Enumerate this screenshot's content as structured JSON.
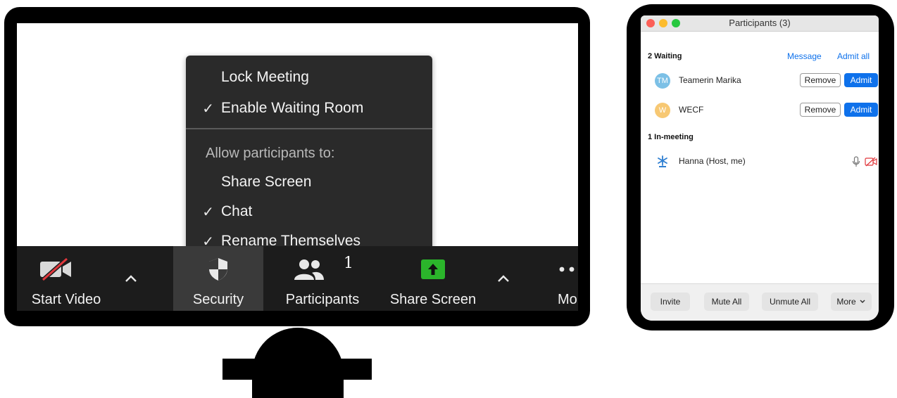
{
  "security_menu": {
    "items": [
      {
        "label": "Lock Meeting",
        "checked": false
      },
      {
        "label": "Enable Waiting Room",
        "checked": true
      }
    ],
    "allow_heading": "Allow participants to:",
    "allow_items": [
      {
        "label": "Share Screen",
        "checked": false
      },
      {
        "label": "Chat",
        "checked": true
      },
      {
        "label": "Rename Themselves",
        "checked": true
      }
    ],
    "check_glyph": "✓"
  },
  "toolbar": {
    "start_video": "Start Video",
    "security": "Security",
    "participants": "Participants",
    "participants_count": "1",
    "share_screen": "Share Screen",
    "more": "More",
    "share_color": "#2bb52b"
  },
  "participants_window": {
    "title": "Participants (3)",
    "waiting_heading": "2 Waiting",
    "message_link": "Message",
    "admit_all_link": "Admit all",
    "waiting": [
      {
        "initials": "TM",
        "name": "Teamerin Marika",
        "avatar_color": "#7cc0e6",
        "remove": "Remove",
        "admit": "Admit"
      },
      {
        "initials": "W",
        "name": "WECF",
        "avatar_color": "#f7c873",
        "remove": "Remove",
        "admit": "Admit"
      }
    ],
    "in_meeting_heading": "1 In-meeting",
    "in_meeting": [
      {
        "name": "Hanna (Host, me)",
        "avatar_icon": "snowflake-icon"
      }
    ],
    "footer": {
      "invite": "Invite",
      "mute_all": "Mute All",
      "unmute_all": "Unmute All",
      "more": "More"
    },
    "accent_color": "#0e71eb"
  }
}
